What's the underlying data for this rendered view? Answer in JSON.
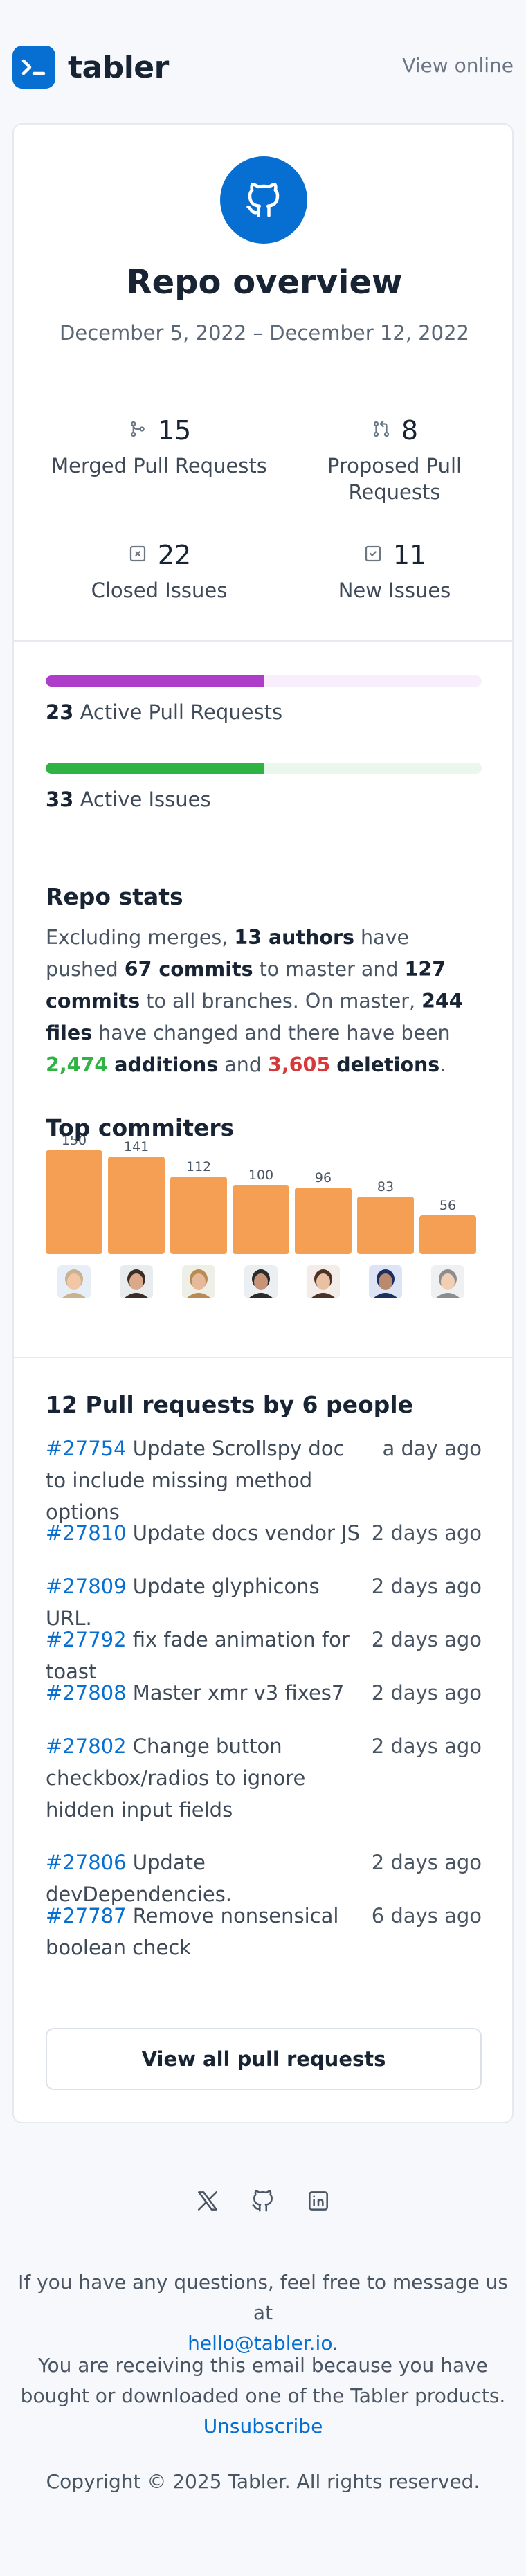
{
  "brand": {
    "name": "tabler",
    "view_online": "View online",
    "accent": "#066fd1"
  },
  "hero": {
    "icon": "github-icon",
    "title": "Repo overview",
    "date_range": "December 5, 2022 – December 12, 2022"
  },
  "metrics": [
    {
      "icon": "git-merge-icon",
      "value": "15",
      "label": "Merged Pull Requests"
    },
    {
      "icon": "git-pull-request-icon",
      "value": "8",
      "label": "Proposed Pull Requests"
    },
    {
      "icon": "square-x-icon",
      "value": "22",
      "label": "Closed Issues"
    },
    {
      "icon": "square-check-icon",
      "value": "11",
      "label": "New Issues"
    }
  ],
  "progress": [
    {
      "count": "23",
      "label": "Active Pull Requests",
      "fill_fraction": 0.5,
      "color": "#ae3ec9",
      "track": "#f9eefc"
    },
    {
      "count": "33",
      "label": "Active Issues",
      "fill_fraction": 0.5,
      "color": "#2fb344",
      "track": "#eaf7ec"
    }
  ],
  "repo_stats": {
    "title": "Repo stats",
    "p1": "Excluding merges, ",
    "authors": "13 authors",
    "p2": " have pushed ",
    "commits_master": "67 commits",
    "p3": " to master and ",
    "commits_all": "127 commits",
    "p4": " to all branches. On master, ",
    "files": "244 files",
    "p5": " have changed and there have been ",
    "additions_num": "2,474",
    "additions_word": "additions",
    "p6": " and ",
    "deletions_num": "3,605",
    "deletions_word": "deletions",
    "p7": "."
  },
  "commiters": {
    "title": "Top commiters",
    "bar_color": "#f59f54"
  },
  "chart_data": {
    "type": "bar",
    "title": "Top commiters",
    "values": [
      150,
      141,
      112,
      100,
      96,
      83,
      56
    ],
    "data_labels": [
      "150",
      "141",
      "112",
      "100",
      "96",
      "83",
      "56"
    ],
    "ylim": [
      0,
      150
    ]
  },
  "pull_requests": {
    "title": "12 Pull requests by 6 people",
    "items": [
      {
        "num": "#27754",
        "text": "Update Scrollspy doc to include missing method options",
        "time": "a day ago"
      },
      {
        "num": "#27810",
        "text": "Update docs vendor JS",
        "time": "2 days ago"
      },
      {
        "num": "#27809",
        "text": "Update glyphicons URL.",
        "time": "2 days ago"
      },
      {
        "num": "#27792",
        "text": "fix fade animation for toast",
        "time": "2 days ago"
      },
      {
        "num": "#27808",
        "text": "Master xmr v3 fixes7",
        "time": "2 days ago"
      },
      {
        "num": "#27802",
        "text": "Change button checkbox/radios to ignore hidden input fields",
        "time": "2 days ago"
      },
      {
        "num": "#27806",
        "text": "Update devDependencies.",
        "time": "2 days ago"
      },
      {
        "num": "#27787",
        "text": "Remove nonsensical boolean check",
        "time": "6 days ago"
      }
    ],
    "button": "View all pull requests"
  },
  "footer": {
    "social_icons": [
      "x-icon",
      "github-icon",
      "linkedin-icon"
    ],
    "questions": "If you have any questions, feel free to message us at",
    "email": "hello@tabler.io",
    "email_suffix": ".",
    "receiving": "You are receiving this email because you have bought or downloaded one of the Tabler products.",
    "unsubscribe": "Unsubscribe",
    "copyright": "Copyright © 2025 Tabler. All rights reserved."
  }
}
